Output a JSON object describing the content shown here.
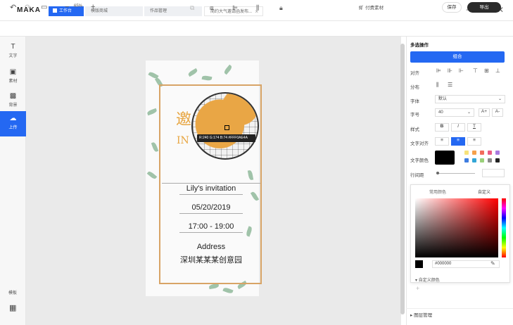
{
  "app": {
    "logo": "MAKA"
  },
  "tabs": [
    {
      "label": "工作台"
    },
    {
      "label": "模版商城"
    },
    {
      "label": "作品管理"
    },
    {
      "label": "简约大气邀请函发布..."
    }
  ],
  "toolbar": {
    "zoom": "65%",
    "paid_material": "付费素材",
    "save": "保存",
    "export": "导出"
  },
  "left_rail": {
    "items": [
      {
        "label": "文字",
        "icon": "T"
      },
      {
        "label": "素材",
        "icon": "▣"
      },
      {
        "label": "背景",
        "icon": "▩"
      },
      {
        "label": "上传",
        "icon": "☁"
      }
    ],
    "bottom_label": "模板"
  },
  "invitation": {
    "heading_char": "邀",
    "heading_latin": "IN",
    "name_line": "Lily's invitation",
    "date": "05/20/2019",
    "time": "17:00 - 19:00",
    "address_label": "Address",
    "address": "深圳某某某创意园"
  },
  "magnifier": {
    "readout": "R:240 G:174 B:74 #FFF0AE4A"
  },
  "panel": {
    "title": "多选操作",
    "group_button": "组合",
    "labels": {
      "align": "对齐",
      "distribute": "分布",
      "font": "字体",
      "size": "字号",
      "style": "样式",
      "text_align": "文字对齐",
      "text_color": "文字颜色",
      "line_height": "行间距"
    },
    "font_value": "默认",
    "size_value": "40",
    "style_buttons": [
      "B",
      "I",
      "T"
    ],
    "font_size_buttons": [
      "A+",
      "A-"
    ],
    "text_color": "#000000"
  },
  "picker": {
    "tabs": [
      "常用颜色",
      "自定义"
    ],
    "hex_value": "#000000",
    "custom_colors_label": "自定义颜色",
    "add_label": "+",
    "bottom_section": "图层管理"
  },
  "swatches": [
    "#f7e27a",
    "#f5a04b",
    "#f26d5b",
    "#e95c86",
    "#a97be0",
    "#3e7de0",
    "#33a6d6",
    "#9ad07a",
    "#888888",
    "#222222"
  ]
}
